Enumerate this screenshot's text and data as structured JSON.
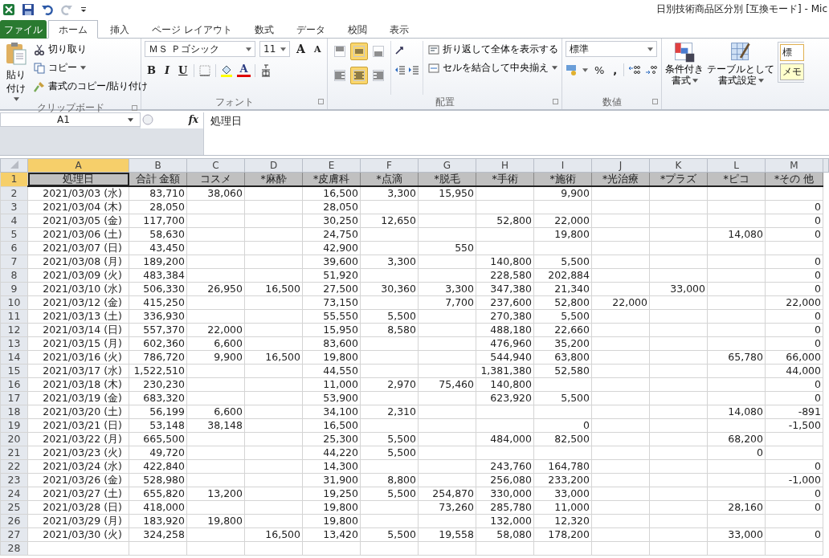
{
  "window": {
    "title": "日別技術商品区分別  [互換モード]  -  Mic"
  },
  "tabs": [
    {
      "label": "ファイル",
      "kind": "file",
      "selected": false
    },
    {
      "label": "ホーム",
      "kind": "tab",
      "selected": true
    },
    {
      "label": "挿入",
      "kind": "tab",
      "selected": false
    },
    {
      "label": "ページ レイアウト",
      "kind": "tab",
      "selected": false
    },
    {
      "label": "数式",
      "kind": "tab",
      "selected": false
    },
    {
      "label": "データ",
      "kind": "tab",
      "selected": false
    },
    {
      "label": "校閲",
      "kind": "tab",
      "selected": false
    },
    {
      "label": "表示",
      "kind": "tab",
      "selected": false
    }
  ],
  "ribbon": {
    "clipboard": {
      "paste": "貼り付け",
      "cut": "切り取り",
      "copy": "コピー",
      "format_painter": "書式のコピー/貼り付け",
      "label": "クリップボード"
    },
    "font": {
      "name": "ＭＳ Ｐゴシック",
      "size": "11",
      "grow": "A",
      "shrink": "A",
      "bold": "B",
      "italic": "I",
      "underline": "U",
      "font_color": "A",
      "label": "フォント"
    },
    "alignment": {
      "align_buttons": [
        {
          "kind": "top",
          "selected": false
        },
        {
          "kind": "middle",
          "selected": true
        },
        {
          "kind": "bottom",
          "selected": false
        },
        {
          "kind": "left",
          "selected": false
        },
        {
          "kind": "center",
          "selected": true
        },
        {
          "kind": "right",
          "selected": false
        }
      ],
      "wrap": "折り返して全体を表示する",
      "merge": "セルを結合して中央揃え",
      "label": "配置"
    },
    "number": {
      "format": "標準",
      "percent": "%",
      "comma": ",",
      "label": "数値"
    },
    "styles": {
      "conditional": [
        "条件付き",
        "書式"
      ],
      "table": [
        "テーブルとして",
        "書式設定"
      ],
      "style_1": "標",
      "style_2": "メモ"
    }
  },
  "formula_bar": {
    "name_box": "A1",
    "fx": "fx",
    "value": "処理日"
  },
  "sheet": {
    "columns": [
      {
        "letter": "A",
        "selected": true
      },
      {
        "letter": "B",
        "selected": false
      },
      {
        "letter": "C",
        "selected": false
      },
      {
        "letter": "D",
        "selected": false
      },
      {
        "letter": "E",
        "selected": false
      },
      {
        "letter": "F",
        "selected": false
      },
      {
        "letter": "G",
        "selected": false
      },
      {
        "letter": "H",
        "selected": false
      },
      {
        "letter": "I",
        "selected": false
      },
      {
        "letter": "J",
        "selected": false
      },
      {
        "letter": "K",
        "selected": false
      },
      {
        "letter": "L",
        "selected": false
      },
      {
        "letter": "M",
        "selected": false
      }
    ],
    "rows": [
      {
        "number": "1",
        "selected": true,
        "kind": "header",
        "cells": [
          "処理日",
          "合計 金額",
          "コスメ",
          "*麻酔",
          "*皮膚科",
          "*点滴",
          "*脱毛",
          "*手術",
          "*施術",
          "*光治療",
          "*プラズ",
          "*ピコ",
          "*その 他"
        ]
      },
      {
        "number": "2",
        "selected": false,
        "kind": "data",
        "cells": [
          "2021/03/03 (水)",
          "83,710",
          "38,060",
          null,
          "16,500",
          "3,300",
          "15,950",
          null,
          "9,900",
          null,
          null,
          null,
          null
        ]
      },
      {
        "number": "3",
        "selected": false,
        "kind": "data",
        "cells": [
          "2021/03/04 (木)",
          "28,050",
          null,
          null,
          "28,050",
          null,
          null,
          null,
          null,
          null,
          null,
          null,
          "0"
        ]
      },
      {
        "number": "4",
        "selected": false,
        "kind": "data",
        "cells": [
          "2021/03/05 (金)",
          "117,700",
          null,
          null,
          "30,250",
          "12,650",
          null,
          "52,800",
          "22,000",
          null,
          null,
          null,
          "0"
        ]
      },
      {
        "number": "5",
        "selected": false,
        "kind": "data",
        "cells": [
          "2021/03/06 (土)",
          "58,630",
          null,
          null,
          "24,750",
          null,
          null,
          null,
          "19,800",
          null,
          null,
          "14,080",
          "0"
        ]
      },
      {
        "number": "6",
        "selected": false,
        "kind": "data",
        "cells": [
          "2021/03/07 (日)",
          "43,450",
          null,
          null,
          "42,900",
          null,
          "550",
          null,
          null,
          null,
          null,
          null,
          null
        ]
      },
      {
        "number": "7",
        "selected": false,
        "kind": "data",
        "cells": [
          "2021/03/08 (月)",
          "189,200",
          null,
          null,
          "39,600",
          "3,300",
          null,
          "140,800",
          "5,500",
          null,
          null,
          null,
          "0"
        ]
      },
      {
        "number": "8",
        "selected": false,
        "kind": "data",
        "cells": [
          "2021/03/09 (火)",
          "483,384",
          null,
          null,
          "51,920",
          null,
          null,
          "228,580",
          "202,884",
          null,
          null,
          null,
          "0"
        ]
      },
      {
        "number": "9",
        "selected": false,
        "kind": "data",
        "cells": [
          "2021/03/10 (水)",
          "506,330",
          "26,950",
          "16,500",
          "27,500",
          "30,360",
          "3,300",
          "347,380",
          "21,340",
          null,
          "33,000",
          null,
          "0"
        ]
      },
      {
        "number": "10",
        "selected": false,
        "kind": "data",
        "cells": [
          "2021/03/12 (金)",
          "415,250",
          null,
          null,
          "73,150",
          null,
          "7,700",
          "237,600",
          "52,800",
          "22,000",
          null,
          null,
          "22,000"
        ]
      },
      {
        "number": "11",
        "selected": false,
        "kind": "data",
        "cells": [
          "2021/03/13 (土)",
          "336,930",
          null,
          null,
          "55,550",
          "5,500",
          null,
          "270,380",
          "5,500",
          null,
          null,
          null,
          "0"
        ]
      },
      {
        "number": "12",
        "selected": false,
        "kind": "data",
        "cells": [
          "2021/03/14 (日)",
          "557,370",
          "22,000",
          null,
          "15,950",
          "8,580",
          null,
          "488,180",
          "22,660",
          null,
          null,
          null,
          "0"
        ]
      },
      {
        "number": "13",
        "selected": false,
        "kind": "data",
        "cells": [
          "2021/03/15 (月)",
          "602,360",
          "6,600",
          null,
          "83,600",
          null,
          null,
          "476,960",
          "35,200",
          null,
          null,
          null,
          "0"
        ]
      },
      {
        "number": "14",
        "selected": false,
        "kind": "data",
        "cells": [
          "2021/03/16 (火)",
          "786,720",
          "9,900",
          "16,500",
          "19,800",
          null,
          null,
          "544,940",
          "63,800",
          null,
          null,
          "65,780",
          "66,000"
        ]
      },
      {
        "number": "15",
        "selected": false,
        "kind": "data",
        "cells": [
          "2021/03/17 (水)",
          "1,522,510",
          null,
          null,
          "44,550",
          null,
          null,
          "1,381,380",
          "52,580",
          null,
          null,
          null,
          "44,000"
        ]
      },
      {
        "number": "16",
        "selected": false,
        "kind": "data",
        "cells": [
          "2021/03/18 (木)",
          "230,230",
          null,
          null,
          "11,000",
          "2,970",
          "75,460",
          "140,800",
          null,
          null,
          null,
          null,
          "0"
        ]
      },
      {
        "number": "17",
        "selected": false,
        "kind": "data",
        "cells": [
          "2021/03/19 (金)",
          "683,320",
          null,
          null,
          "53,900",
          null,
          null,
          "623,920",
          "5,500",
          null,
          null,
          null,
          "0"
        ]
      },
      {
        "number": "18",
        "selected": false,
        "kind": "data",
        "cells": [
          "2021/03/20 (土)",
          "56,199",
          "6,600",
          null,
          "34,100",
          "2,310",
          null,
          null,
          null,
          null,
          null,
          "14,080",
          "-891"
        ]
      },
      {
        "number": "19",
        "selected": false,
        "kind": "data",
        "cells": [
          "2021/03/21 (日)",
          "53,148",
          "38,148",
          null,
          "16,500",
          null,
          null,
          null,
          "0",
          null,
          null,
          null,
          "-1,500"
        ]
      },
      {
        "number": "20",
        "selected": false,
        "kind": "data",
        "cells": [
          "2021/03/22 (月)",
          "665,500",
          null,
          null,
          "25,300",
          "5,500",
          null,
          "484,000",
          "82,500",
          null,
          null,
          "68,200",
          null
        ]
      },
      {
        "number": "21",
        "selected": false,
        "kind": "data",
        "cells": [
          "2021/03/23 (火)",
          "49,720",
          null,
          null,
          "44,220",
          "5,500",
          null,
          null,
          null,
          null,
          null,
          "0",
          null
        ]
      },
      {
        "number": "22",
        "selected": false,
        "kind": "data",
        "cells": [
          "2021/03/24 (水)",
          "422,840",
          null,
          null,
          "14,300",
          null,
          null,
          "243,760",
          "164,780",
          null,
          null,
          null,
          "0"
        ]
      },
      {
        "number": "23",
        "selected": false,
        "kind": "data",
        "cells": [
          "2021/03/26 (金)",
          "528,980",
          null,
          null,
          "31,900",
          "8,800",
          null,
          "256,080",
          "233,200",
          null,
          null,
          null,
          "-1,000"
        ]
      },
      {
        "number": "24",
        "selected": false,
        "kind": "data",
        "cells": [
          "2021/03/27 (土)",
          "655,820",
          "13,200",
          null,
          "19,250",
          "5,500",
          "254,870",
          "330,000",
          "33,000",
          null,
          null,
          null,
          "0"
        ]
      },
      {
        "number": "25",
        "selected": false,
        "kind": "data",
        "cells": [
          "2021/03/28 (日)",
          "418,000",
          null,
          null,
          "19,800",
          null,
          "73,260",
          "285,780",
          "11,000",
          null,
          null,
          "28,160",
          "0"
        ]
      },
      {
        "number": "26",
        "selected": false,
        "kind": "data",
        "cells": [
          "2021/03/29 (月)",
          "183,920",
          "19,800",
          null,
          "19,800",
          null,
          null,
          "132,000",
          "12,320",
          null,
          null,
          null,
          null
        ]
      },
      {
        "number": "27",
        "selected": false,
        "kind": "data",
        "cells": [
          "2021/03/30 (火)",
          "324,258",
          null,
          "16,500",
          "13,420",
          "5,500",
          "19,558",
          "58,080",
          "178,200",
          null,
          null,
          "33,000",
          "0"
        ]
      },
      {
        "number": "28",
        "selected": false,
        "kind": "empty"
      }
    ]
  }
}
